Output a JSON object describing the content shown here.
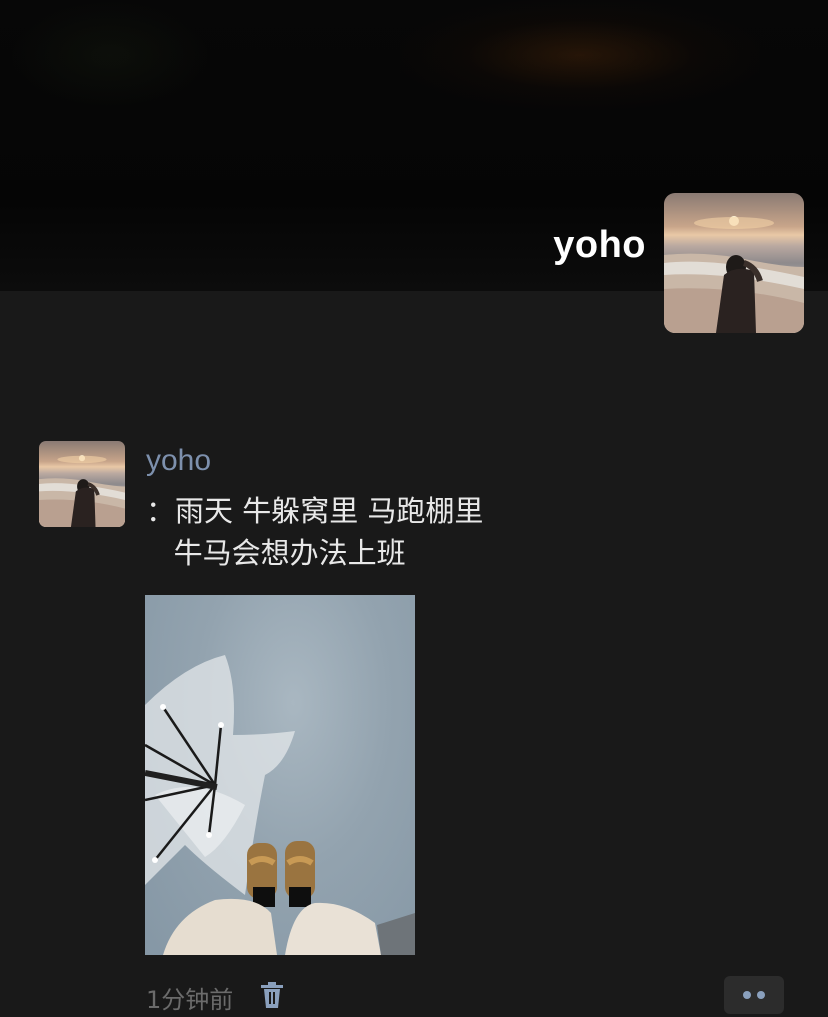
{
  "owner": {
    "name": "yoho"
  },
  "post": {
    "author": "yoho",
    "text": "：雨天 牛躲窝里 马跑棚里\n   牛马会想办法上班",
    "time": "1分钟前",
    "actions": {
      "delete_icon": "trash-icon",
      "more_icon": "more-dots-icon"
    }
  },
  "colors": {
    "background": "#191919",
    "author_name": "#7d90ad",
    "timestamp": "#6b6b6b",
    "more_dots": "#8aa0bd"
  }
}
